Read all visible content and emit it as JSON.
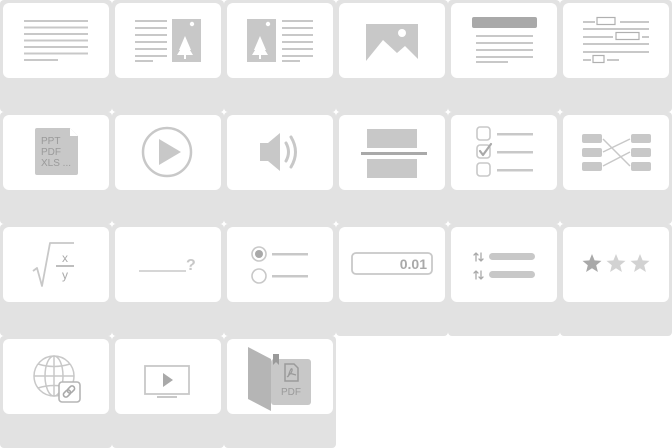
{
  "colors": {
    "tile_background": "#e2e2e2",
    "tile_face": "#ffffff",
    "icon": "#c8c8c8",
    "icon_dark": "#a9a9a9"
  },
  "tiles": [
    {
      "icon": "text-block-icon",
      "label": ""
    },
    {
      "icon": "text-with-image-right-icon",
      "label": ""
    },
    {
      "icon": "image-with-text-right-icon",
      "label": ""
    },
    {
      "icon": "image-icon",
      "label": ""
    },
    {
      "icon": "heading-with-text-icon",
      "label": ""
    },
    {
      "icon": "fill-in-blanks-text-icon",
      "label": ""
    },
    {
      "icon": "document-file-icon",
      "label": "",
      "text": {
        "line1": "PPT",
        "line2": "PDF",
        "line3": "XLS ..."
      }
    },
    {
      "icon": "video-play-icon",
      "label": ""
    },
    {
      "icon": "audio-speaker-icon",
      "label": ""
    },
    {
      "icon": "divider-block-icon",
      "label": ""
    },
    {
      "icon": "checkbox-list-icon",
      "label": ""
    },
    {
      "icon": "matching-pairs-icon",
      "label": ""
    },
    {
      "icon": "formula-icon",
      "label": "",
      "text": {
        "numerator": "x",
        "denominator": "y"
      }
    },
    {
      "icon": "fill-blank-question-icon",
      "label": "",
      "text": {
        "mark": "?"
      }
    },
    {
      "icon": "radio-list-icon",
      "label": ""
    },
    {
      "icon": "numeric-input-icon",
      "label": "",
      "text": {
        "value": "0.01"
      }
    },
    {
      "icon": "sortable-list-icon",
      "label": ""
    },
    {
      "icon": "star-rating-icon",
      "label": "",
      "rating": {
        "filled": 1,
        "total": 3
      }
    },
    {
      "icon": "web-link-icon",
      "label": ""
    },
    {
      "icon": "video-embed-icon",
      "label": ""
    },
    {
      "icon": "pdf-book-icon",
      "label": "",
      "text": {
        "caption": "PDF"
      }
    }
  ]
}
